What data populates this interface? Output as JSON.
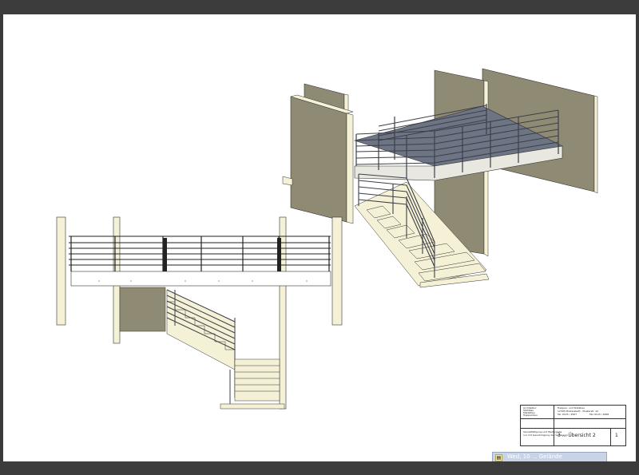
{
  "window": {
    "background_color": "#3a3a3a",
    "sheet_color": "#ffffff"
  },
  "drawing": {
    "views": [
      "isometric-view",
      "elevation-view"
    ],
    "colors": {
      "wall_beige": "#f5f1d6",
      "wall_shadow": "#8f8a74",
      "landing_slab": "#e8e8e0",
      "railing_steel": "#3c3f48",
      "floor_plate": "#6d7484"
    }
  },
  "title_block": {
    "header_lines": [
      "Architektur",
      "Stahlbau",
      "Metallbau",
      "Treppenbau"
    ],
    "company": "Treppen- und Stahlbau",
    "address": "12345 Musterstadt · Musterstr. 12",
    "phone": "Tel. 0123 / 4567",
    "fax": "Fax 0123 / 4568",
    "notes": [
      "Vervielfältigung und Weitergabe",
      "nur mit Genehmigung des Verfassers"
    ],
    "drawing_name": "3 ... Übersicht 2",
    "sheet_number": "1"
  },
  "status": {
    "icon": "document-icon",
    "text": "Wed, 10 ... Gelände"
  }
}
